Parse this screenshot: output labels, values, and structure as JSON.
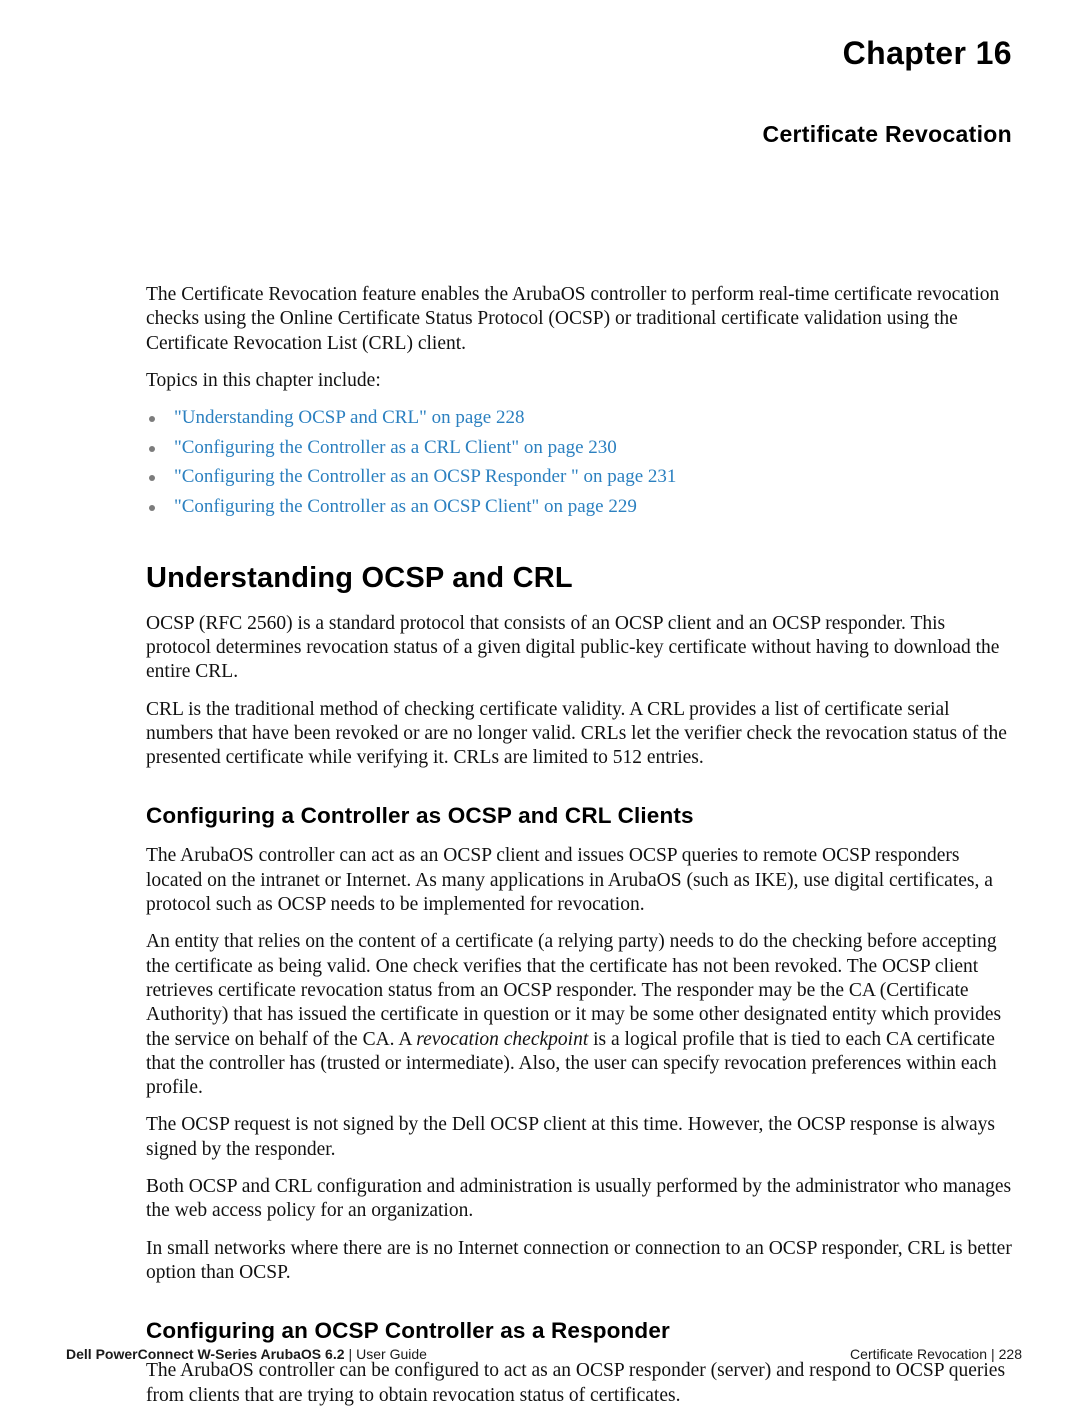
{
  "document": {
    "chapter_label": "Chapter  16",
    "chapter_subtitle": "Certificate Revocation"
  },
  "intro": {
    "paragraph_1": "The Certificate Revocation feature enables the ArubaOS  controller to perform real-time certificate revocation checks using the Online Certificate Status Protocol (OCSP) or traditional certificate validation using the Certificate Revocation List (CRL) client.",
    "paragraph_2": "Topics in this chapter include:"
  },
  "topics": [
    {
      "label": "\"Understanding OCSP and CRL\" on page 228"
    },
    {
      "label": "\"Configuring the Controller as a CRL Client\" on page 230"
    },
    {
      "label": "\"Configuring the Controller as an OCSP Responder \" on page 231"
    },
    {
      "label": "\"Configuring the Controller as an OCSP Client\" on page 229"
    }
  ],
  "sections": [
    {
      "heading": "Understanding OCSP and CRL",
      "paragraph_1": "OCSP (RFC 2560) is a standard protocol that consists of an OCSP client and an OCSP responder. This protocol determines revocation status of a given digital public-key certificate without having to download the entire CRL.",
      "paragraph_2": "CRL is the traditional method of checking certificate validity. A CRL provides a list of certificate serial numbers that have been revoked or are no longer valid. CRLs let the verifier check the revocation status of the presented certificate while verifying it. CRLs are limited to 512 entries."
    }
  ],
  "subsection_ocsp_crl_clients": {
    "heading": "Configuring a Controller as OCSP and CRL Clients",
    "paragraph_1": "The ArubaOS  controller can act as an OCSP client and issues OCSP queries to remote OCSP responders located on the intranet or Internet. As many applications in ArubaOS (such as IKE), use digital certificates, a protocol such as OCSP needs to be implemented for revocation.",
    "paragraph_2_part_a": "An entity that relies on the content of a certificate (a relying party) needs to do the checking before accepting the certificate as being valid. One check verifies that the certificate has not been revoked. The OCSP client retrieves certificate revocation status from an OCSP responder. The responder may be the CA (Certificate Authority) that has issued the certificate in question or it may be some other designated entity which provides the service on behalf of the CA. A ",
    "paragraph_2_italic": "revocation checkpoint",
    "paragraph_2_part_b": " is a logical profile that is tied to each CA certificate that the controller has (trusted or intermediate). Also, the user can specify revocation preferences within each profile.",
    "paragraph_3": "The OCSP request is not signed by the Dell OCSP client at this time. However, the OCSP response is always signed by the responder.",
    "paragraph_4": "Both OCSP and CRL configuration and administration is usually performed by the administrator who manages the web access policy for an organization.",
    "paragraph_5": "In small networks where there are is no Internet connection or connection to an OCSP responder, CRL is better option than OCSP."
  },
  "subsection_ocsp_responder": {
    "heading": "Configuring an OCSP Controller as a Responder",
    "paragraph_1": "The ArubaOS  controller can be configured to act as an OCSP responder (server) and respond to OCSP queries from clients that are trying to obtain revocation status of certificates."
  },
  "footer": {
    "product": "Dell PowerConnect W-Series ArubaOS 6.2",
    "separator": "|",
    "doc_type": "User Guide",
    "chapter_name": "Certificate Revocation",
    "page_number": "228"
  },
  "colors": {
    "link": "#2b80c0",
    "bullet": "#7c7c7c",
    "text": "#111111",
    "background": "#ffffff"
  }
}
